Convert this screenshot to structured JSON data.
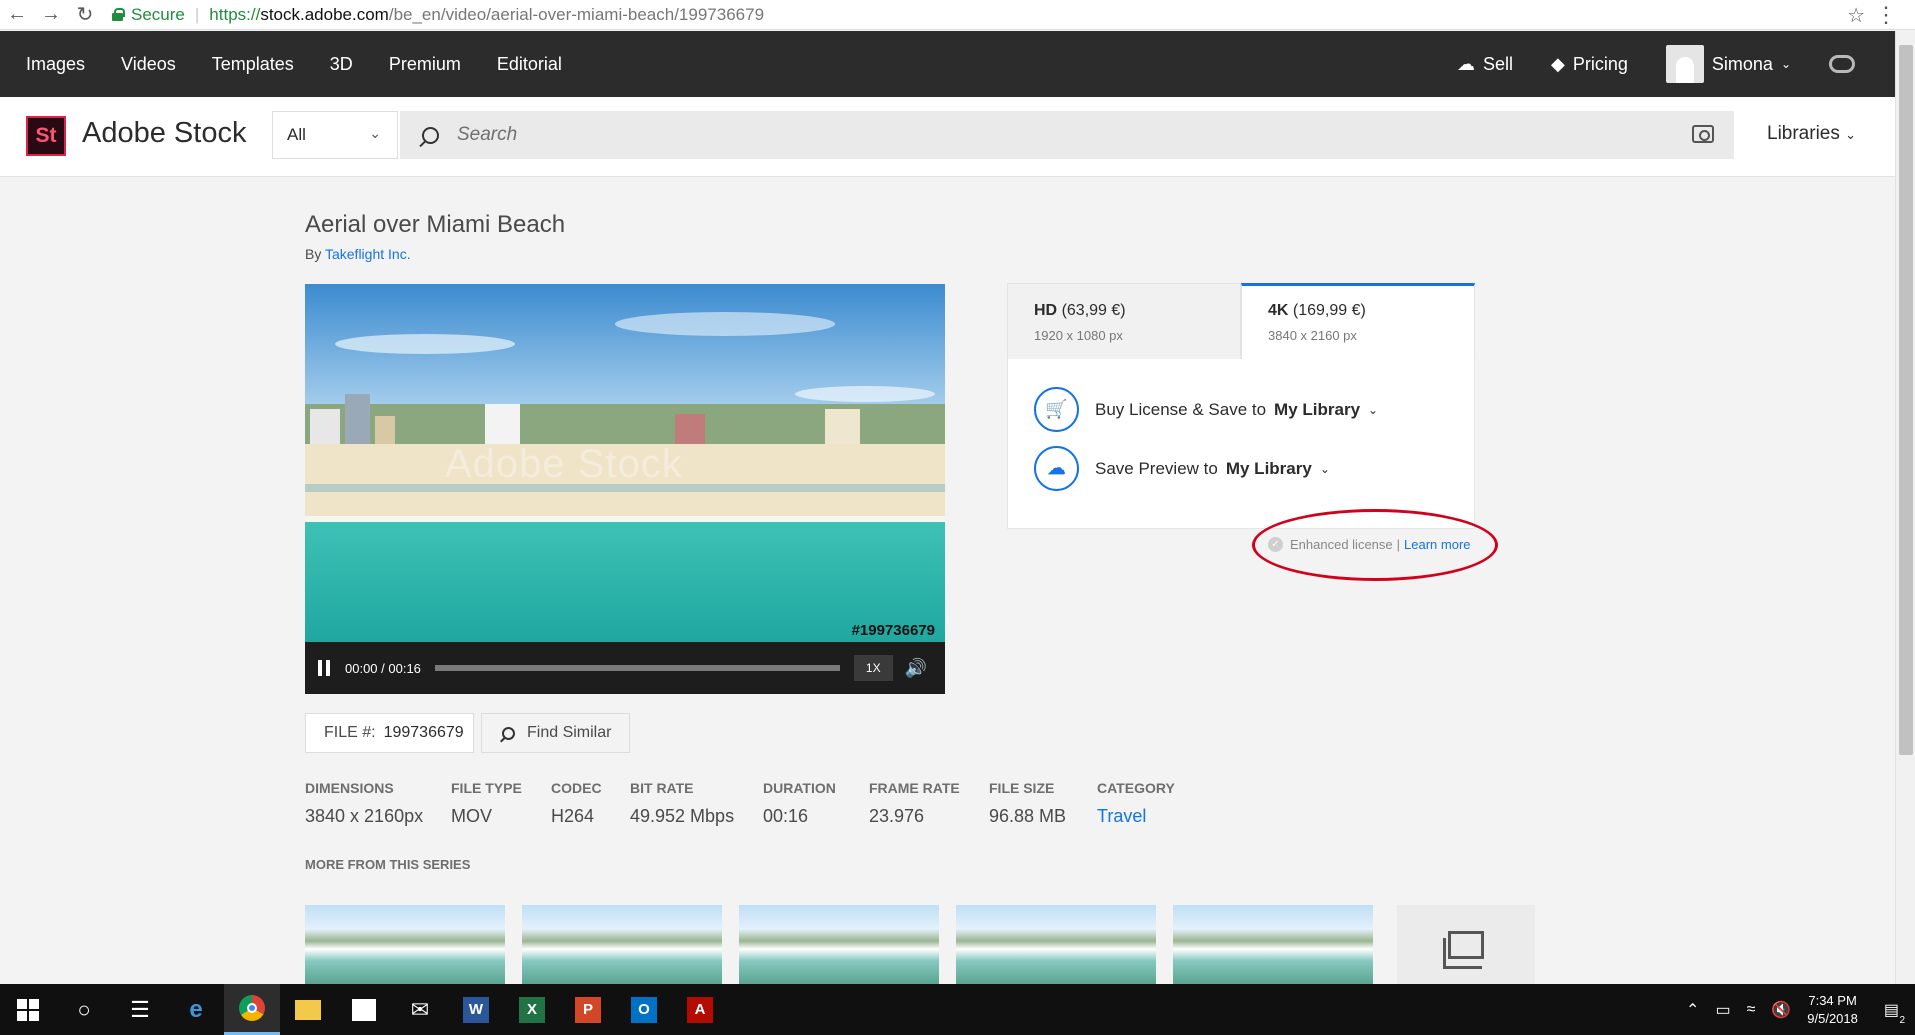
{
  "browser": {
    "secure_label": "Secure",
    "url_proto": "https://",
    "url_host": "stock.adobe.com",
    "url_path": "/be_en/video/aerial-over-miami-beach/199736679"
  },
  "topnav": {
    "items": [
      "Images",
      "Videos",
      "Templates",
      "3D",
      "Premium",
      "Editorial"
    ],
    "sell": "Sell",
    "pricing": "Pricing",
    "user": "Simona"
  },
  "header": {
    "logo_mark": "St",
    "logo_text": "Adobe Stock",
    "category": "All",
    "search_placeholder": "Search",
    "libraries": "Libraries"
  },
  "asset": {
    "title": "Aerial over Miami Beach",
    "by_prefix": "By",
    "author": "Takeflight Inc.",
    "watermark": "Adobe Stock",
    "id_overlay": "#199736679",
    "time": "00:00 / 00:16",
    "speed": "1X",
    "progress": 0
  },
  "license": {
    "tabs": [
      {
        "name": "HD",
        "price": "(63,99 €)",
        "res": "1920 x 1080 px"
      },
      {
        "name": "4K",
        "price": "(169,99 €)",
        "res": "3840 x 2160 px"
      }
    ],
    "buy_label": "Buy License & Save to",
    "buy_target": "My Library",
    "preview_label": "Save Preview to",
    "preview_target": "My Library",
    "enhanced": "Enhanced license",
    "learn_more": "Learn more"
  },
  "file": {
    "label": "FILE #:",
    "number": "199736679",
    "find_similar": "Find Similar"
  },
  "specs": [
    {
      "label": "DIMENSIONS",
      "value": "3840 x 2160px"
    },
    {
      "label": "FILE TYPE",
      "value": "MOV"
    },
    {
      "label": "CODEC",
      "value": "H264"
    },
    {
      "label": "BIT RATE",
      "value": "49.952 Mbps"
    },
    {
      "label": "DURATION",
      "value": "00:16"
    },
    {
      "label": "FRAME RATE",
      "value": "23.976"
    },
    {
      "label": "FILE SIZE",
      "value": "96.88 MB"
    },
    {
      "label": "CATEGORY",
      "value": "Travel"
    }
  ],
  "series_label": "MORE FROM THIS SERIES",
  "taskbar": {
    "time": "7:34 PM",
    "date": "9/5/2018",
    "notif_count": "2"
  },
  "colors": {
    "accent": "#1473e6",
    "nav_bg": "#2c2c2c",
    "highlight_ring": "#d0021b"
  }
}
